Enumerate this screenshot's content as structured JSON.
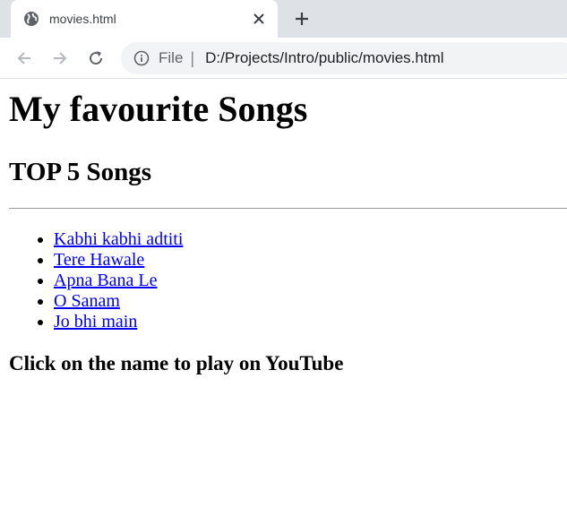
{
  "browser": {
    "tab": {
      "title": "movies.html",
      "icon": "globe-icon"
    },
    "omnibox": {
      "scheme_label": "File",
      "separator": "|",
      "url": "D:/Projects/Intro/public/movies.html"
    }
  },
  "page": {
    "heading": "My favourite Songs",
    "subheading": "TOP 5 Songs",
    "songs": [
      {
        "label": "Kabhi kabhi adtiti"
      },
      {
        "label": "Tere Hawale"
      },
      {
        "label": "Apna Bana Le"
      },
      {
        "label": "O Sanam"
      },
      {
        "label": "Jo bhi main"
      }
    ],
    "footer_note": "Click on the name to play on YouTube"
  },
  "colors": {
    "link": "#0000ee",
    "tab_strip": "#dee1e6",
    "omnibox_bg": "#f1f3f4"
  }
}
